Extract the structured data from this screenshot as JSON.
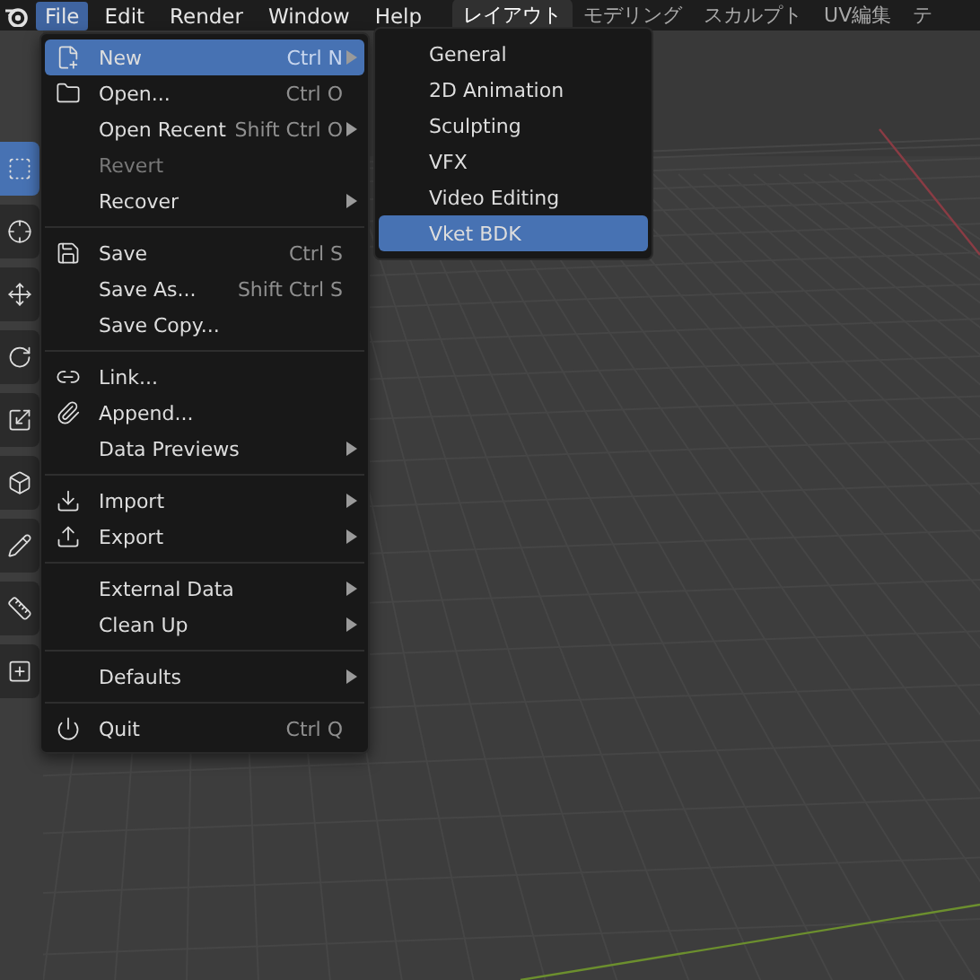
{
  "top_bar": {
    "menus": [
      {
        "label": "File",
        "selected": true
      },
      {
        "label": "Edit",
        "selected": false
      },
      {
        "label": "Render",
        "selected": false
      },
      {
        "label": "Window",
        "selected": false
      },
      {
        "label": "Help",
        "selected": false
      }
    ],
    "workspace_tabs": [
      {
        "label": "レイアウト",
        "selected": true
      },
      {
        "label": "モデリング",
        "selected": false
      },
      {
        "label": "スカルプト",
        "selected": false
      },
      {
        "label": "UV編集",
        "selected": false
      },
      {
        "label": "テ",
        "selected": false
      }
    ]
  },
  "toolbar": {
    "tools": [
      {
        "kind": "select",
        "selected": true
      },
      {
        "kind": "cursor",
        "selected": false
      },
      {
        "kind": "move",
        "selected": false
      },
      {
        "kind": "rotate",
        "selected": false
      },
      {
        "kind": "scale",
        "selected": false
      },
      {
        "kind": "transform",
        "selected": false
      },
      {
        "kind": "annotate",
        "selected": false
      },
      {
        "kind": "measure",
        "selected": false
      },
      {
        "kind": "add",
        "selected": false
      }
    ]
  },
  "file_menu": {
    "items": [
      {
        "kind": "item",
        "label": "New",
        "shortcut": "Ctrl N",
        "submenu": true,
        "selected": true,
        "disabled": false
      },
      {
        "kind": "item",
        "label": "Open...",
        "shortcut": "Ctrl O",
        "submenu": false,
        "selected": false,
        "disabled": false
      },
      {
        "kind": "item",
        "label": "Open Recent",
        "shortcut": "Shift Ctrl O",
        "submenu": true,
        "selected": false,
        "disabled": false
      },
      {
        "kind": "item",
        "label": "Revert",
        "submenu": false,
        "selected": false,
        "disabled": true
      },
      {
        "kind": "item",
        "label": "Recover",
        "submenu": true,
        "selected": false,
        "disabled": false
      },
      {
        "kind": "separator"
      },
      {
        "kind": "item",
        "label": "Save",
        "shortcut": "Ctrl S",
        "submenu": false,
        "selected": false,
        "disabled": false
      },
      {
        "kind": "item",
        "label": "Save As...",
        "shortcut": "Shift Ctrl S",
        "submenu": false,
        "selected": false,
        "disabled": false
      },
      {
        "kind": "item",
        "label": "Save Copy...",
        "submenu": false,
        "selected": false,
        "disabled": false
      },
      {
        "kind": "separator"
      },
      {
        "kind": "item",
        "label": "Link...",
        "submenu": false,
        "selected": false,
        "disabled": false
      },
      {
        "kind": "item",
        "label": "Append...",
        "submenu": false,
        "selected": false,
        "disabled": false
      },
      {
        "kind": "item",
        "label": "Data Previews",
        "submenu": true,
        "selected": false,
        "disabled": false
      },
      {
        "kind": "separator"
      },
      {
        "kind": "item",
        "label": "Import",
        "submenu": true,
        "selected": false,
        "disabled": false
      },
      {
        "kind": "item",
        "label": "Export",
        "submenu": true,
        "selected": false,
        "disabled": false
      },
      {
        "kind": "separator"
      },
      {
        "kind": "item",
        "label": "External Data",
        "submenu": true,
        "selected": false,
        "disabled": false
      },
      {
        "kind": "item",
        "label": "Clean Up",
        "submenu": true,
        "selected": false,
        "disabled": false
      },
      {
        "kind": "separator"
      },
      {
        "kind": "item",
        "label": "Defaults",
        "submenu": true,
        "selected": false,
        "disabled": false
      },
      {
        "kind": "separator"
      },
      {
        "kind": "item",
        "label": "Quit",
        "shortcut": "Ctrl Q",
        "submenu": false,
        "selected": false,
        "disabled": false
      }
    ]
  },
  "new_submenu": {
    "items": [
      {
        "label": "General",
        "selected": false
      },
      {
        "label": "2D Animation",
        "selected": false
      },
      {
        "label": "Sculpting",
        "selected": false
      },
      {
        "label": "VFX",
        "selected": false
      },
      {
        "label": "Video Editing",
        "selected": false
      },
      {
        "label": "Vket BDK",
        "selected": true
      }
    ]
  }
}
